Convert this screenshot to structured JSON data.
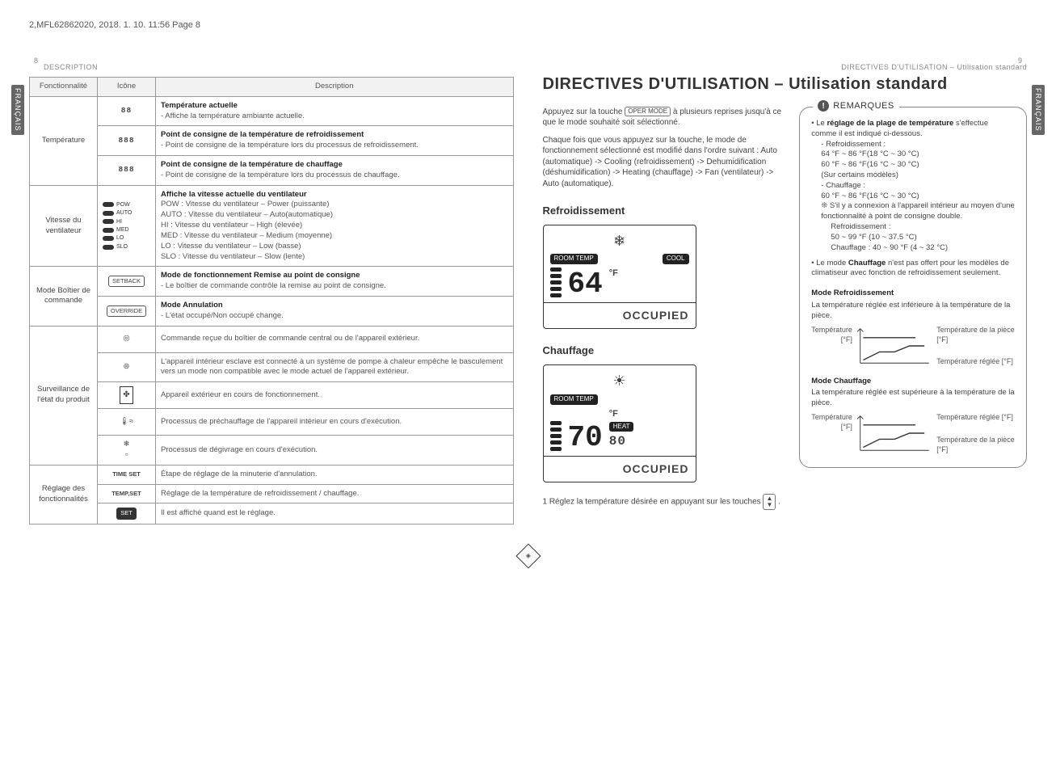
{
  "meta_top": "2,MFL62862020,    2018. 1. 10.    11:56  Page 8",
  "left": {
    "page_no": "8",
    "header": "DESCRIPTION",
    "side_tab": "FRANÇAIS",
    "th": {
      "func": "Fonctionnalité",
      "icon": "Icône",
      "desc": "Description"
    },
    "rows": {
      "r1": {
        "func": "Température",
        "icon": "88",
        "title": "Température actuelle",
        "body": "- Affiche la température ambiante actuelle."
      },
      "r2": {
        "icon": "888",
        "title": "Point de consigne de la température de refroidissement",
        "body": "- Point de consigne de la température lors du processus de refroidissement."
      },
      "r3": {
        "icon": "888",
        "title": "Point de consigne de la température de chauffage",
        "body": "- Point de consigne de la température lors du processus de chauffage."
      },
      "r4": {
        "func": "Vitesse du ventilateur",
        "fan_labels": [
          "POW",
          "AUTO",
          "HI",
          "MED",
          "LO",
          "SLO"
        ],
        "title": "Affiche la vitesse actuelle du ventilateur",
        "lines": [
          "POW : Vitesse du ventilateur – Power (puissante)",
          "AUTO : Vitesse du ventilateur – Auto(automatique)",
          "HI : Vitesse du ventilateur – High (élevée)",
          "MED : Vitesse du ventilateur – Medium (moyenne)",
          "LO : Vitesse du ventilateur – Low (basse)",
          "SLO : Vitesse du ventilateur – Slow (lente)"
        ]
      },
      "r5": {
        "func": "Mode Boîtier de commande",
        "icon": "SETBACK",
        "title": "Mode de fonctionnement Remise au point de consigne",
        "body": "- Le boîtier de commande contrôle la remise au point de consigne."
      },
      "r6": {
        "icon": "OVERRIDE",
        "title": "Mode Annulation",
        "body": "- L'état occupé/Non occupé change."
      },
      "r7": {
        "func": "Surveillance de l'état du produit",
        "body": "Commande reçue du boîtier de commande central ou de l'appareil extérieur."
      },
      "r8": {
        "body": "L'appareil intérieur esclave est connecté à un système de pompe à chaleur empêche le basculement vers un mode non compatible avec le mode actuel de l'appareil extérieur."
      },
      "r9": {
        "body": "Appareil extérieur en cours de fonctionnement."
      },
      "r10": {
        "body": "Processus de préchauffage de l'appareil intérieur en cours d'exécution."
      },
      "r11": {
        "body": "Processus de dégivrage en cours d'exécution."
      },
      "r12": {
        "func": "Réglage des fonctionnalités",
        "icon": "TIME SET",
        "body": "Étape de réglage de la minuterie d'annulation."
      },
      "r13": {
        "icon": "TEMP,SET",
        "body": "Réglage de la température de refroidissement / chauffage."
      },
      "r14": {
        "icon": "SET",
        "body": "Il est affiché quand est le réglage."
      }
    }
  },
  "right": {
    "page_no": "9",
    "header": "DIRECTIVES D'UTILISATION – Utilisation standard",
    "side_tab": "FRANÇAIS",
    "title": "DIRECTIVES D'UTILISATION – Utilisation standard",
    "intro1a": "Appuyez sur la touche ",
    "intro1b": " à plusieurs reprises jusqu'à ce que le mode souhaité soit sélectionné.",
    "key_label": "OPER MODE",
    "intro2": "Chaque fois que vous appuyez sur la touche, le mode de fonctionnement sélectionné est modifié dans l'ordre suivant : Auto (automatique) -> Cooling (refroidissement) -> Dehumidification (déshumidification) -> Heating (chauffage) -> Fan (ventilateur) -> Auto (automatique).",
    "sec_cool": "Refroidissement",
    "lcd_cool": {
      "room": "ROOM TEMP",
      "cool": "COOL",
      "temp": "64",
      "unit": "°F",
      "occ": "OCCUPIED"
    },
    "sec_heat": "Chauffage",
    "lcd_heat": {
      "room": "ROOM TEMP",
      "heat": "HEAT",
      "temp": "70",
      "unit": "°F",
      "extra": "80",
      "occ": "OCCUPIED"
    },
    "step1a": "1   Réglez la température désirée en appuyant sur les touches ",
    "step1b": ".",
    "remarks": {
      "head": "REMARQUES",
      "bullet1_strong": "réglage de la plage de température",
      "bullet1_pre": "• Le ",
      "bullet1_post": " s'effectue comme il est indiqué ci-dessous.",
      "cool_head": "- Refroidissement :",
      "cool_lines": [
        "64 °F ~ 86 °F(18 °C ~ 30 °C)",
        "60 °F ~ 86 °F(16 °C ~ 30 °C)",
        "(Sur certains modèles)"
      ],
      "heat_head": "- Chauffage :",
      "heat_line": "60 °F ~ 86 °F(16 °C ~ 30 °C)",
      "dual_lines": [
        "❊ S'il y a connexion à l'appareil intérieur au moyen d'une fonctionnalité à point de consigne double.",
        "Refroidissement :",
        "50 ~ 99 °F (10 ~ 37.5 °C)",
        "Chauffage : 40 ~ 90 °F (4 ~ 32 °C)"
      ],
      "bullet2_strong": "Chauffage",
      "bullet2_pre": "• Le mode ",
      "bullet2_post": " n'est pas offert pour les modèles de climatiseur avec fonction de refroidissement seulement.",
      "mode_cool_head": "Mode Refroidissement",
      "mode_cool_body": "La température réglée est inférieure à la température de la pièce.",
      "mode_heat_head": "Mode Chauffage",
      "mode_heat_body": "La température réglée est supérieure à la température de la pièce.",
      "axis_y": "Température [°F]",
      "lab_room": "Température de la pièce [°F]",
      "lab_set": "Température réglée [°F]"
    }
  },
  "chart_data": [
    {
      "type": "line",
      "title": "Mode Refroidissement",
      "ylabel": "Température [°F]",
      "series": [
        {
          "name": "Température de la pièce",
          "shape": "flat-high",
          "position": "upper"
        },
        {
          "name": "Température réglée",
          "shape": "rising-step-below-room",
          "position": "lower"
        }
      ],
      "note": "Qualitative diagram — no numeric axis ticks shown; room temperature line is above set temperature line."
    },
    {
      "type": "line",
      "title": "Mode Chauffage",
      "ylabel": "Température [°F]",
      "series": [
        {
          "name": "Température réglée",
          "shape": "flat-high",
          "position": "upper"
        },
        {
          "name": "Température de la pièce",
          "shape": "rising-step-below-set",
          "position": "lower"
        }
      ],
      "note": "Qualitative diagram — no numeric axis ticks shown; set temperature line is above room temperature line."
    }
  ]
}
